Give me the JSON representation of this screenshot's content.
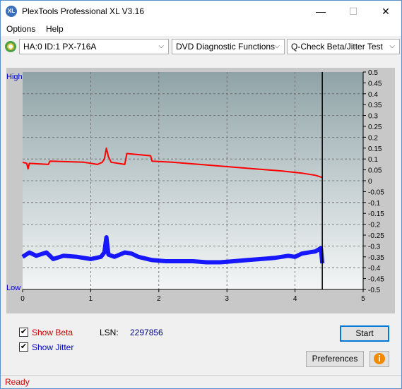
{
  "window": {
    "title": "PlexTools Professional XL V3.16",
    "app_icon_text": "XL",
    "minimize": "—",
    "maximize": "☐",
    "close": "✕"
  },
  "menu": {
    "options_label": "Options",
    "help_label": "Help"
  },
  "toolbar": {
    "drive": "HA:0 ID:1  PX-716A",
    "function": "DVD Diagnostic Functions",
    "test": "Q-Check Beta/Jitter Test",
    "arrow": "⌵"
  },
  "chart_data": {
    "type": "line",
    "x_range": [
      0,
      5
    ],
    "x_ticks": [
      "0",
      "1",
      "2",
      "3",
      "4",
      "5"
    ],
    "left_labels": {
      "top": "High",
      "bottom": "Low"
    },
    "right_range": [
      -0.5,
      0.5
    ],
    "right_ticks": [
      "0.5",
      "0.45",
      "0.4",
      "0.35",
      "0.3",
      "0.25",
      "0.2",
      "0.15",
      "0.1",
      "0.05",
      "0",
      "-0.05",
      "-0.1",
      "-0.15",
      "-0.2",
      "-0.25",
      "-0.3",
      "-0.35",
      "-0.4",
      "-0.45",
      "-0.5"
    ],
    "end_marker_x": 4.4,
    "grid": true,
    "series": [
      {
        "color": "#ff0000",
        "points": [
          [
            0,
            0.085
          ],
          [
            0.06,
            0.08
          ],
          [
            0.08,
            0.055
          ],
          [
            0.1,
            0.08
          ],
          [
            0.38,
            0.075
          ],
          [
            0.4,
            0.09
          ],
          [
            0.9,
            0.085
          ],
          [
            1.1,
            0.075
          ],
          [
            1.17,
            0.085
          ],
          [
            1.2,
            0.1
          ],
          [
            1.23,
            0.15
          ],
          [
            1.26,
            0.11
          ],
          [
            1.3,
            0.085
          ],
          [
            1.5,
            0.075
          ],
          [
            1.53,
            0.125
          ],
          [
            1.7,
            0.12
          ],
          [
            1.88,
            0.115
          ],
          [
            1.9,
            0.09
          ],
          [
            2.2,
            0.085
          ],
          [
            2.6,
            0.075
          ],
          [
            3.0,
            0.065
          ],
          [
            3.4,
            0.055
          ],
          [
            3.8,
            0.045
          ],
          [
            4.1,
            0.035
          ],
          [
            4.3,
            0.025
          ],
          [
            4.4,
            0.015
          ]
        ]
      },
      {
        "color": "#0000ff",
        "points": [
          [
            0,
            -0.35
          ],
          [
            0.1,
            -0.33
          ],
          [
            0.2,
            -0.345
          ],
          [
            0.35,
            -0.33
          ],
          [
            0.45,
            -0.36
          ],
          [
            0.6,
            -0.345
          ],
          [
            0.8,
            -0.35
          ],
          [
            1.0,
            -0.36
          ],
          [
            1.15,
            -0.35
          ],
          [
            1.2,
            -0.33
          ],
          [
            1.23,
            -0.26
          ],
          [
            1.26,
            -0.34
          ],
          [
            1.35,
            -0.35
          ],
          [
            1.5,
            -0.33
          ],
          [
            1.6,
            -0.335
          ],
          [
            1.7,
            -0.35
          ],
          [
            1.9,
            -0.365
          ],
          [
            2.1,
            -0.37
          ],
          [
            2.3,
            -0.37
          ],
          [
            2.5,
            -0.37
          ],
          [
            2.7,
            -0.375
          ],
          [
            2.9,
            -0.375
          ],
          [
            3.1,
            -0.37
          ],
          [
            3.3,
            -0.365
          ],
          [
            3.5,
            -0.36
          ],
          [
            3.7,
            -0.355
          ],
          [
            3.9,
            -0.345
          ],
          [
            4.0,
            -0.35
          ],
          [
            4.1,
            -0.335
          ],
          [
            4.2,
            -0.33
          ],
          [
            4.3,
            -0.325
          ],
          [
            4.38,
            -0.31
          ],
          [
            4.4,
            -0.38
          ]
        ]
      }
    ]
  },
  "options": {
    "show_beta_label": "Show Beta",
    "show_jitter_label": "Show Jitter",
    "show_beta_checked": true,
    "show_jitter_checked": true,
    "check_mark": "✔",
    "lsn_label": "LSN:",
    "lsn_value": "2297856",
    "beta_color": "#cc0000",
    "jitter_color": "#0000cc"
  },
  "buttons": {
    "start": "Start",
    "preferences": "Preferences",
    "info": "i"
  },
  "status": {
    "text": "Ready",
    "color": "#cc0000"
  }
}
